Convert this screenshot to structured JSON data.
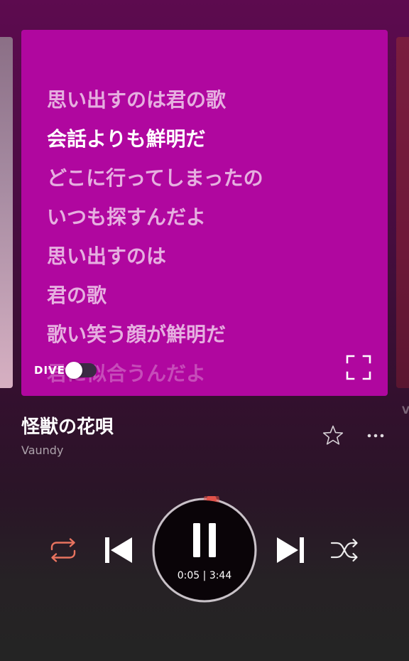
{
  "lyrics": {
    "lines": [
      "思い出すのは君の歌",
      "会話よりも鮮明だ",
      "どこに行ってしまったの",
      "いつも探すんだよ",
      "思い出すのは",
      "君の歌",
      "歌い笑う顔が鮮明だ",
      "君に似合うんだよ"
    ],
    "current_line_index": 1
  },
  "dive": {
    "label": "DIVE",
    "enabled": false
  },
  "right_card_ghost_text": "V",
  "track": {
    "title": "怪獣の花唄",
    "artist": "Vaundy"
  },
  "playback": {
    "elapsed": "0:05",
    "separator": "|",
    "duration": "3:44",
    "progress_fraction": 0.022,
    "state": "playing"
  },
  "colors": {
    "lyrics_card": "#b0079f",
    "accent": "#e8735f",
    "progress_knob": "#e0524a"
  },
  "icons": {
    "fullscreen": "fullscreen-icon",
    "favorite": "star-outline-icon",
    "more": "more-horizontal-icon",
    "repeat": "repeat-icon",
    "previous": "skip-previous-icon",
    "pause": "pause-icon",
    "next": "skip-next-icon",
    "shuffle": "shuffle-icon"
  }
}
